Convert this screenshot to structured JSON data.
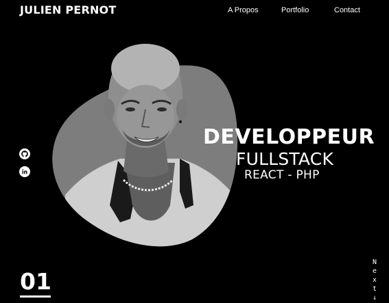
{
  "header": {
    "brand": "JULIEN PERNOT",
    "nav": [
      {
        "label": "A Propos"
      },
      {
        "label": "Portfolio"
      },
      {
        "label": "Contact"
      }
    ]
  },
  "hero": {
    "title": "DEVELOPPEUR",
    "subtitle": "FULLSTACK",
    "stack": "REACT - PHP",
    "photo_icon": "portrait-photo"
  },
  "social": {
    "github_icon": "github-icon",
    "linkedin_icon": "linkedin-icon"
  },
  "section": {
    "number": "01"
  },
  "next": {
    "letters": [
      "N",
      "e",
      "x",
      "t",
      "↓"
    ]
  },
  "colors": {
    "background": "#000000",
    "blob": "#7d7d7d",
    "text": "#ffffff"
  }
}
